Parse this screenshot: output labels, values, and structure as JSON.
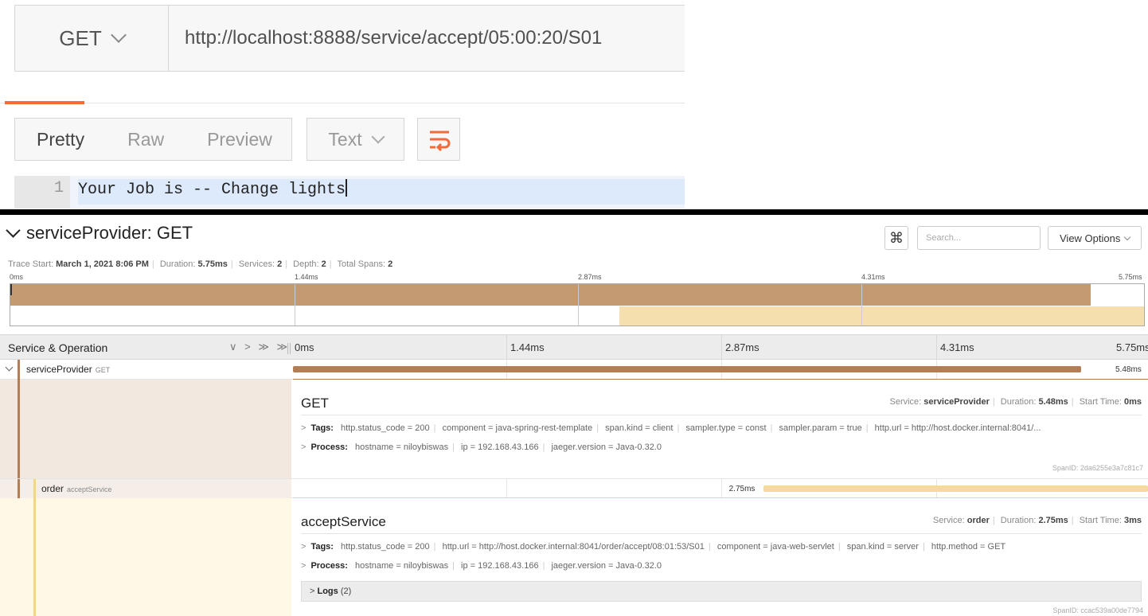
{
  "postman": {
    "method": "GET",
    "url": "http://localhost:8888/service/accept/05:00:20/S01",
    "view_tabs": [
      "Pretty",
      "Raw",
      "Preview"
    ],
    "format": "Text",
    "line_number": "1",
    "response_line": "Your Job is -- Change lights",
    "accent_color": "#f26b3a"
  },
  "jaeger": {
    "trace_title": "serviceProvider: GET",
    "search_placeholder": "Search...",
    "view_options": "View Options",
    "cmd_symbol": "⌘",
    "meta": {
      "trace_start_label": "Trace Start:",
      "trace_start": "March 1, 2021 8:06 PM",
      "duration_label": "Duration:",
      "duration": "5.75ms",
      "services_label": "Services:",
      "services": "2",
      "depth_label": "Depth:",
      "depth": "2",
      "total_spans_label": "Total Spans:",
      "total_spans": "2"
    },
    "ticks": [
      "0ms",
      "1.44ms",
      "2.87ms",
      "4.31ms",
      "5.75ms"
    ],
    "header": {
      "label": "Service & Operation",
      "controls": "∨ > ≫ ≫"
    },
    "spans": [
      {
        "service": "serviceProvider",
        "operation": "GET",
        "duration": "5.48ms",
        "start_fraction": 0.0,
        "duration_fraction": 0.953,
        "color": "#b37d55",
        "detail": {
          "title": "GET",
          "service_label": "Service:",
          "service": "serviceProvider",
          "duration_label": "Duration:",
          "duration": "5.48ms",
          "start_label": "Start Time:",
          "start": "0ms",
          "tags_label": "Tags:",
          "tags": [
            "http.status_code = 200",
            "component = java-spring-rest-template",
            "span.kind = client",
            "sampler.type = const",
            "sampler.param = true",
            "http.url = http://host.docker.internal:8041/..."
          ],
          "process_label": "Process:",
          "process": [
            "hostname = niloybiswas",
            "ip = 192.168.43.166",
            "jaeger.version = Java-0.32.0"
          ],
          "span_id": "SpanID: 2da6255e3a7c81c7"
        }
      },
      {
        "service": "order",
        "operation": "acceptService",
        "duration": "2.75ms",
        "start_fraction": 0.522,
        "duration_fraction": 0.478,
        "color": "#f6d99b",
        "detail": {
          "title": "acceptService",
          "service_label": "Service:",
          "service": "order",
          "duration_label": "Duration:",
          "duration": "2.75ms",
          "start_label": "Start Time:",
          "start": "3ms",
          "tags_label": "Tags:",
          "tags": [
            "http.status_code = 200",
            "http.url = http://host.docker.internal:8041/order/accept/08:01:53/S01",
            "component = java-web-servlet",
            "span.kind = server",
            "http.method = GET"
          ],
          "process_label": "Process:",
          "process": [
            "hostname = niloybiswas",
            "ip = 192.168.43.166",
            "jaeger.version = Java-0.32.0"
          ],
          "logs_label": "Logs",
          "logs_count": "(2)",
          "span_id": "SpanID: ccac539a00de7794"
        }
      }
    ]
  }
}
